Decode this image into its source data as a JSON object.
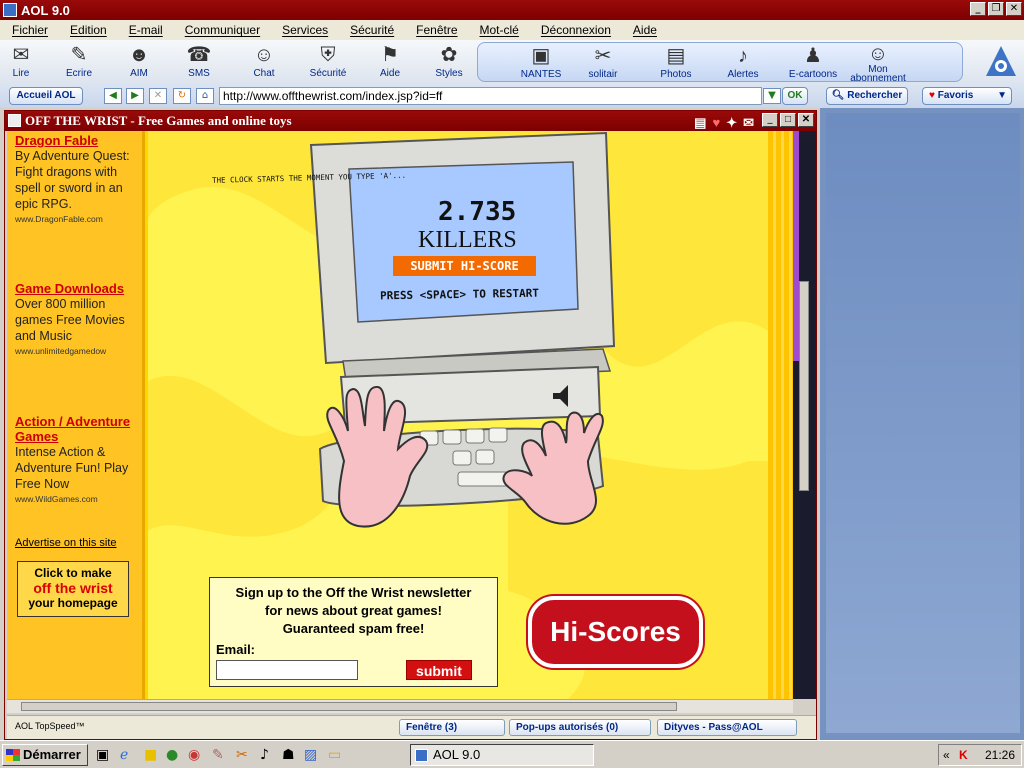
{
  "window": {
    "title": "AOL 9.0"
  },
  "menu": [
    "Fichier",
    "Edition",
    "E-mail",
    "Communiquer",
    "Services",
    "Sécurité",
    "Fenêtre",
    "Mot-clé",
    "Déconnexion",
    "Aide"
  ],
  "toolbar": {
    "items": [
      "Lire",
      "Ecrire",
      "AIM",
      "SMS",
      "Chat",
      "Sécurité",
      "Aide",
      "Styles"
    ],
    "panel_items": [
      "NANTES",
      "solitair",
      "Photos",
      "Alertes",
      "E-cartoons",
      "Mon abonnement"
    ]
  },
  "addressbar": {
    "home_label": "Accueil AOL",
    "url": "http://www.offthewrist.com/index.jsp?id=ff",
    "ok_label": "OK",
    "search_label": "Rechercher",
    "favorites_label": "Favoris"
  },
  "inner": {
    "title": "OFF THE WRIST - Free Games and online toys"
  },
  "ads": [
    {
      "title": "Dragon Fable",
      "desc": "By Adventure Quest: Fight dragons with spell or sword in an epic RPG.",
      "url": "www.DragonFable.com"
    },
    {
      "title": "Game Downloads",
      "desc": "Over 800 million games Free Movies and Music",
      "url": "www.unlimitedgamedow"
    },
    {
      "title": "Action / Adventure Games",
      "desc": "Intense Action & Adventure Fun! Play Free Now",
      "url": "www.WildGames.com"
    }
  ],
  "advertise_link": "Advertise on this site",
  "homepage_box": {
    "l1": "Click to make",
    "l2": "off the wrist",
    "l3": "your homepage"
  },
  "game": {
    "note": "THE CLOCK STARTS THE MOMENT YOU TYPE 'A'...",
    "score": "2.735",
    "unit": "KILLERS",
    "submit": "SUBMIT HI-SCORE",
    "restart": "PRESS <SPACE> TO RESTART"
  },
  "newsletter": {
    "text1": "Sign up to the Off the Wrist newsletter",
    "text2": "for news about great games!",
    "text3": "Guaranteed spam free!",
    "email_label": "Email:",
    "submit": "submit"
  },
  "hiscores": "Hi-Scores",
  "status": {
    "left": "AOL TopSpeed™",
    "windows": "Fenêtre (3)",
    "popups": "Pop-ups autorisés (0)",
    "user": "Dityves - Pass@AOL"
  },
  "taskbar": {
    "start": "Démarrer",
    "task": "AOL 9.0",
    "time": "21:26"
  },
  "colors": {
    "aol_red": "#7d0000",
    "yellow": "#ffd600",
    "link_red": "#cc0000"
  }
}
